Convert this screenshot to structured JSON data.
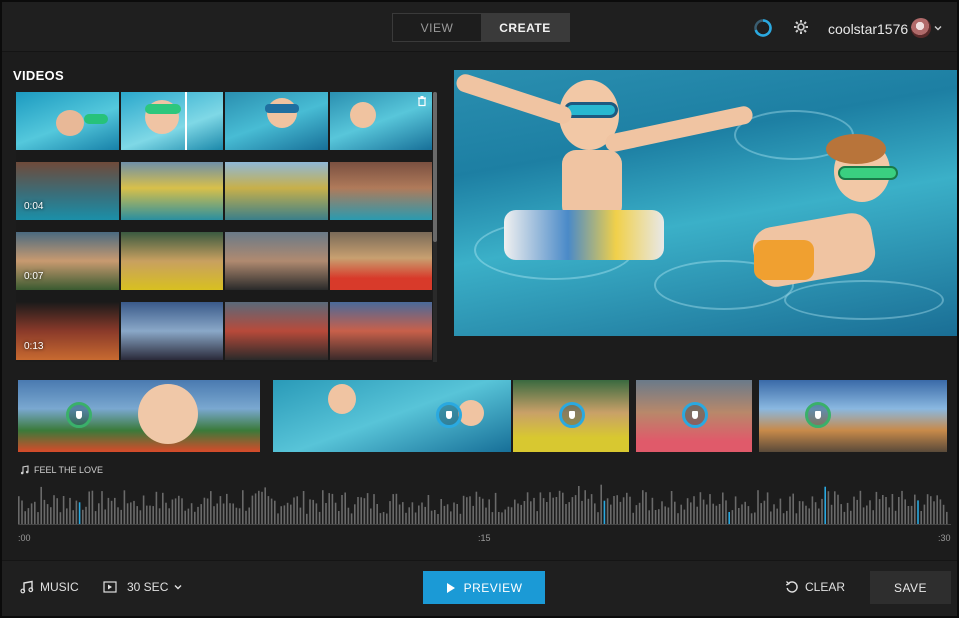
{
  "header": {
    "tabs": [
      {
        "label": "VIEW",
        "active": false
      },
      {
        "label": "CREATE",
        "active": true
      }
    ],
    "username": "coolstar1576",
    "icons": [
      "spinner-icon",
      "gear-icon",
      "avatar",
      "chevron-down-icon"
    ]
  },
  "videos": {
    "title": "VIDEOS",
    "rows": [
      {
        "duration": ""
      },
      {
        "duration": "0:04"
      },
      {
        "duration": "0:07"
      },
      {
        "duration": "0:13"
      }
    ]
  },
  "music": {
    "track": "FEEL THE LOVE",
    "time_labels": [
      ":00",
      ":15",
      ":30"
    ]
  },
  "footer": {
    "music_label": "MUSIC",
    "duration_label": "30 SEC",
    "preview_label": "PREVIEW",
    "clear_label": "CLEAR",
    "save_label": "SAVE"
  },
  "colors": {
    "accent": "#1b9ad6",
    "marker_blue": "#2aa9e0",
    "marker_green": "#3ab06a",
    "background": "#1c1c1c"
  }
}
